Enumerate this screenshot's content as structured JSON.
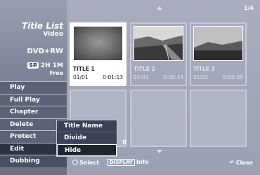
{
  "left_panel": {
    "title": "Title List",
    "subtitle": "Video",
    "disc": "DVD+RW",
    "capacity_badge": "SP",
    "capacity": "2H 1M",
    "free": "Free"
  },
  "menu": [
    {
      "label": "Play"
    },
    {
      "label": "Full Play"
    },
    {
      "label": "Chapter"
    },
    {
      "label": "Delete"
    },
    {
      "label": "Protect"
    },
    {
      "label": "Edit"
    },
    {
      "label": "Dubbing"
    }
  ],
  "submenu": [
    {
      "label": "Title Name"
    },
    {
      "label": "Divide"
    },
    {
      "label": "Hide"
    }
  ],
  "page_indicator": "1/4",
  "titles": [
    {
      "name": "TITLE 1",
      "date": "01/01",
      "duration": "0:01:13"
    },
    {
      "name": "TITLE 2",
      "date": "01/01",
      "duration": "0:00:34"
    },
    {
      "name": "TITLE 3",
      "date": "01/01",
      "duration": "0:00:05"
    }
  ],
  "partial_hidden_text": "0",
  "bottom": {
    "select": "Select",
    "display_key": "DISPLAY",
    "info": "Info",
    "close": "Close"
  },
  "colors": {
    "accent_dark": "#2e3344",
    "panel": "#9ba1b5"
  }
}
